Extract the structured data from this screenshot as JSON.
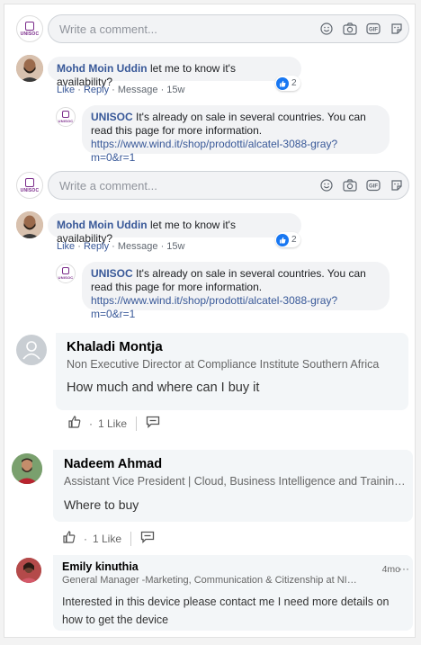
{
  "fb_threads": [
    {
      "comment_placeholder": "Write a comment...",
      "brand_logo_text": "UNISOC",
      "comment": {
        "author": "Mohd Moin Uddin",
        "text": "let me to know it's availability?",
        "like": "Like",
        "reply": "Reply",
        "message": "Message",
        "time": "15w",
        "reactions": "2"
      },
      "reply": {
        "author": "UNISOC",
        "text": "It's already on sale in several countries. You can read this page for more information.",
        "link": "https://www.wind.it/shop/prodotti/alcatel-3088-gray?m=0&r=1"
      }
    },
    {
      "comment_placeholder": "Write a comment...",
      "brand_logo_text": "UNISOC",
      "comment": {
        "author": "Mohd Moin Uddin",
        "text": "let me to know it's availability?",
        "like": "Like",
        "reply": "Reply",
        "message": "Message",
        "time": "15w",
        "reactions": "2"
      },
      "reply": {
        "author": "UNISOC",
        "text": "It's already on sale in several countries. You can read this page for more information.",
        "link": "https://www.wind.it/shop/prodotti/alcatel-3088-gray?m=0&r=1"
      }
    }
  ],
  "li_comments": [
    {
      "name": "Khaladi Montja",
      "title": "Non Executive Director at Compliance Institute Southern Africa",
      "text": "How much and where can I buy it",
      "likes": "1 Like"
    },
    {
      "name": "Nadeem Ahmad",
      "title": "Assistant Vice President | Cloud, Business Intelligence and Training ...",
      "text": "Where to buy",
      "likes": "1 Like"
    },
    {
      "name": "Emily kinuthia",
      "title": "General Manager -Marketing, Communication & Citizenship at NIC...",
      "text": "Interested in this device please contact me I need more details on how to get the device",
      "time": "4mo",
      "more": "···"
    }
  ],
  "colors": {
    "fb_link": "#385898",
    "fb_like": "#1877f2",
    "li_bg": "#f3f6f8",
    "brand": "#7a2a8a"
  }
}
